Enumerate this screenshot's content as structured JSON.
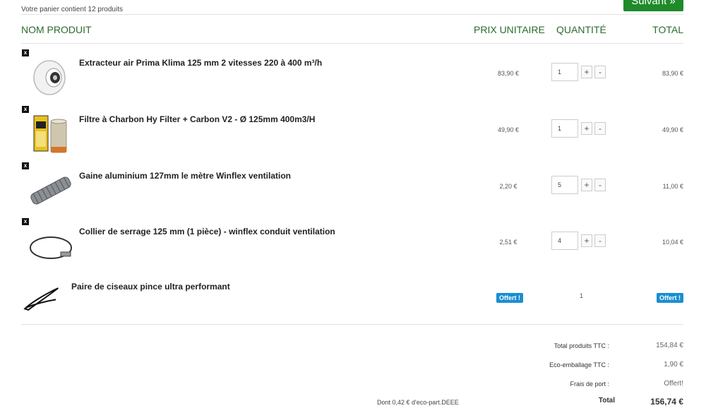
{
  "cart": {
    "count_text": "Votre panier contient 12 produits",
    "next_button": "Suivant »"
  },
  "headers": {
    "product": "NOM PRODUIT",
    "unit_price": "PRIX UNITAIRE",
    "quantity": "QUANTITÉ",
    "total": "TOTAL"
  },
  "items": [
    {
      "name": "Extracteur air Prima Klima 125 mm 2 vitesses 220 à 400 m³/h",
      "unit_price": "83,90 €",
      "quantity": "1",
      "total": "83,90 €",
      "remove": "x",
      "plus": "+",
      "minus": "-",
      "icon": "fan-icon"
    },
    {
      "name": "Filtre à Charbon Hy Filter + Carbon V2 - Ø 125mm 400m3/H",
      "unit_price": "49,90 €",
      "quantity": "1",
      "total": "49,90 €",
      "remove": "x",
      "plus": "+",
      "minus": "-",
      "icon": "filter-icon"
    },
    {
      "name": "Gaine aluminium 127mm le mètre Winflex ventilation",
      "unit_price": "2,20 €",
      "quantity": "5",
      "total": "11,00 €",
      "remove": "x",
      "plus": "+",
      "minus": "-",
      "icon": "duct-icon"
    },
    {
      "name": "Collier de serrage 125 mm (1 pièce) - winflex conduit ventilation",
      "unit_price": "2,51 €",
      "quantity": "4",
      "total": "10,04 €",
      "remove": "x",
      "plus": "+",
      "minus": "-",
      "icon": "clamp-icon"
    }
  ],
  "gift": {
    "name": "Paire de ciseaux pince ultra performant",
    "unit_price": "Offert !",
    "quantity": "1",
    "total": "Offert !",
    "icon": "scissors-icon"
  },
  "summary": {
    "products_label": "Total produits TTC :",
    "products_value": "154,84 €",
    "eco_label": "Eco-emballage TTC :",
    "eco_value": "1,90 €",
    "shipping_label": "Frais de port :",
    "shipping_value": "Offert!",
    "eco_part_note": "Dont 0,42 € d'eco-part.DEEE",
    "total_label": "Total",
    "total_value": "156,74 €"
  },
  "colors": {
    "brand_green": "#1e8a2a",
    "header_green": "#2c6b2f",
    "badge_blue": "#1a8ed1"
  }
}
